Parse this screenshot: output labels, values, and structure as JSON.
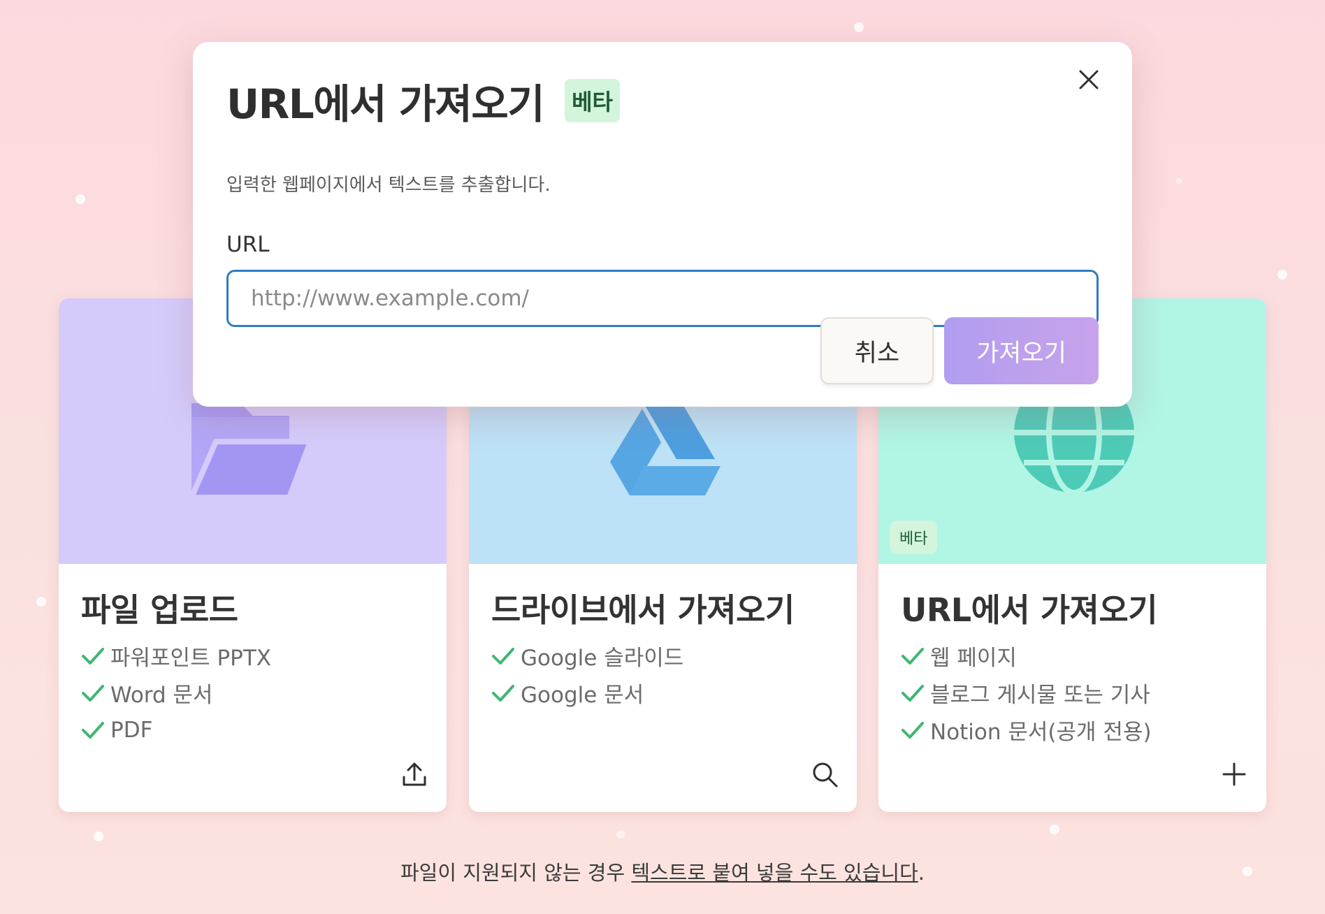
{
  "modal": {
    "title": "URL에서 가져오기",
    "badge": "베타",
    "subtitle": "입력한 웹페이지에서 텍스트를 추출합니다.",
    "url_label": "URL",
    "url_placeholder": "http://www.example.com/",
    "url_value": "",
    "cancel_label": "취소",
    "submit_label": "가져오기",
    "close_icon": "close-icon"
  },
  "cards": [
    {
      "title": "파일 업로드",
      "icon": "folder-icon",
      "action_icon": "upload-icon",
      "items": [
        "파워포인트 PPTX",
        "Word 문서",
        "PDF"
      ]
    },
    {
      "title": "드라이브에서 가져오기",
      "icon": "google-drive-icon",
      "action_icon": "search-icon",
      "items": [
        "Google 슬라이드",
        "Google 문서"
      ]
    },
    {
      "title": "URL에서 가져오기",
      "icon": "globe-icon",
      "action_icon": "plus-icon",
      "badge": "베타",
      "items": [
        "웹 페이지",
        "블로그 게시물 또는 기사",
        "Notion 문서(공개 전용)"
      ]
    }
  ],
  "footer": {
    "text": "파일이 지원되지 않는 경우 ",
    "link": "텍스트로 붙여 넣을 수도 있습니다",
    "suffix": "."
  },
  "colors": {
    "accent_blue": "#2f7bc6",
    "check_green": "#3fb772",
    "badge_bg": "#d2f5dc",
    "primary_button": "#b19df0"
  }
}
